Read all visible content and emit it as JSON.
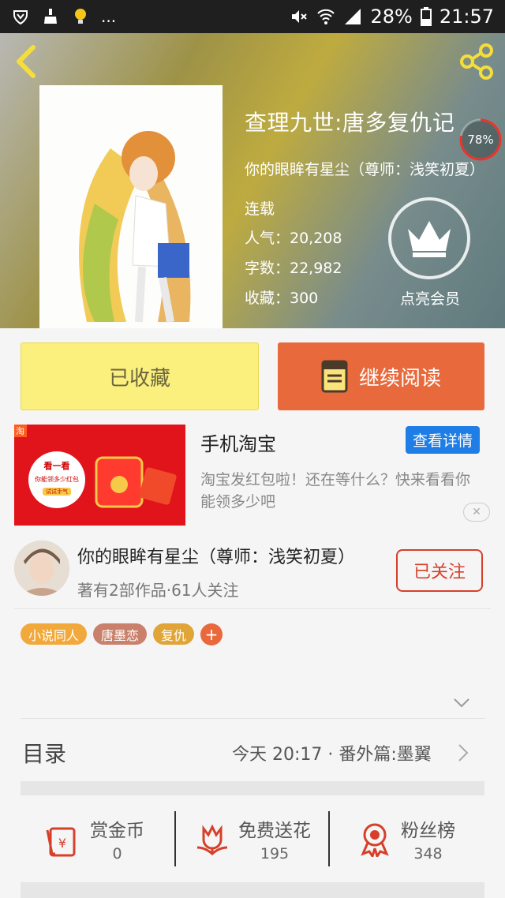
{
  "status_bar": {
    "left_icons": [
      "shield-icon",
      "broom-icon",
      "bulb-icon"
    ],
    "overflow": "...",
    "battery": "28%",
    "time": "21:57"
  },
  "book": {
    "title": "查理九世:唐多复仇记",
    "author_line": "你的眼眸有星尘（尊师：浅笑初夏）",
    "status": "连载",
    "popularity": "人气：20,208",
    "word_count": "字数：22,982",
    "favorites": "收藏：300",
    "read_progress": "78%",
    "vip_label": "点亮会员"
  },
  "actions": {
    "favorited_label": "已收藏",
    "continue_label": "继续阅读"
  },
  "ad": {
    "title": "手机淘宝",
    "button_label": "查看详情",
    "description": "淘宝发红包啦！还在等什么？快来看看你能领多少吧",
    "badge": "淘",
    "promo_heading": "看一看",
    "promo_sub": "你能领多少红包",
    "promo_try": "试试手气"
  },
  "author": {
    "name": "你的眼眸有星尘（尊师：浅笑初夏）",
    "meta": "著有2部作品·61人关注",
    "follow_label": "已关注"
  },
  "tags": [
    {
      "label": "小说同人",
      "color": "#f2a93b"
    },
    {
      "label": "唐墨恋",
      "color": "#c9816b"
    },
    {
      "label": "复仇",
      "color": "#e0a437"
    }
  ],
  "tag_add": "+",
  "toc": {
    "label": "目录",
    "latest": "今天 20:17 · 番外篇:墨翼"
  },
  "bottom_stats": [
    {
      "label": "赏金币",
      "value": "0",
      "icon": "red-envelope-icon"
    },
    {
      "label": "免费送花",
      "value": "195",
      "icon": "flower-icon"
    },
    {
      "label": "粉丝榜",
      "value": "348",
      "icon": "medal-icon"
    }
  ],
  "colors": {
    "accent": "#e8693c",
    "favorite_bg": "#fbf07e",
    "follow_red": "#d6402a",
    "ad_blue": "#1e7ee6"
  }
}
